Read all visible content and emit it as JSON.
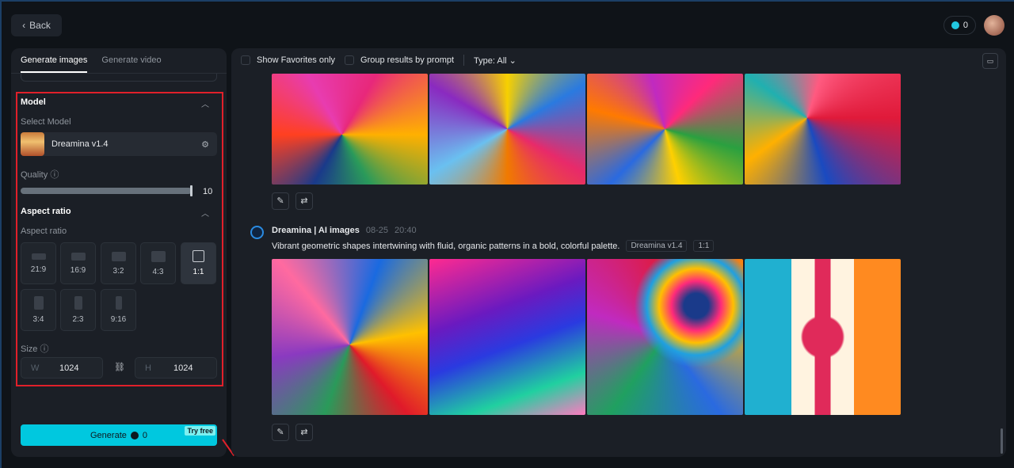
{
  "header": {
    "back_label": "Back",
    "credits": "0"
  },
  "left": {
    "tabs": [
      "Generate images",
      "Generate video"
    ],
    "model_title": "Model",
    "select_model_label": "Select Model",
    "model_name": "Dreamina v1.4",
    "quality_label": "Quality",
    "quality_value": "10",
    "aspect_title": "Aspect ratio",
    "aspect_label": "Aspect ratio",
    "ratios": [
      "21:9",
      "16:9",
      "3:2",
      "4:3",
      "1:1",
      "3:4",
      "2:3",
      "9:16"
    ],
    "selected_ratio": "1:1",
    "size_label": "Size",
    "width_prefix": "W",
    "width": "1024",
    "height_prefix": "H",
    "height": "1024",
    "generate_label": "Generate",
    "generate_cost": "0",
    "try_free": "Try free"
  },
  "right": {
    "show_favorites": "Show Favorites only",
    "group_results": "Group results by prompt",
    "type_filter": "Type: All",
    "author": "Dreamina | AI images",
    "date": "08-25",
    "time": "20:40",
    "prompt": "Vibrant geometric shapes intertwining with fluid, organic patterns in a bold, colorful palette.",
    "model_tag": "Dreamina v1.4",
    "ratio_tag": "1:1"
  }
}
